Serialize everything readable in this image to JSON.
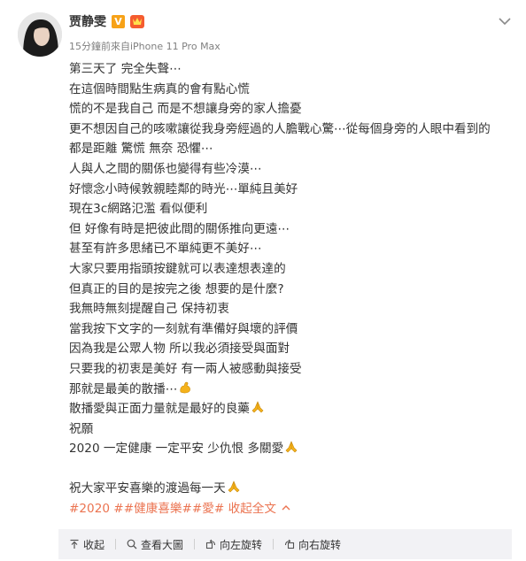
{
  "post": {
    "author": "贾静雯",
    "meta": "15分鐘前來自iPhone 11 Pro Max",
    "verified_badge": "V",
    "lines": [
      "第三天了 完全失聲⋯",
      "在這個時間點生病真的會有點心慌",
      "慌的不是我自己 而是不想讓身旁的家人擔憂",
      "更不想因自己的咳嗽讓從我身旁經過的人膽戰心驚⋯從每個身旁的人眼中看到的",
      "都是距離 驚慌 無奈 恐懼⋯",
      "人與人之間的關係也變得有些冷漠⋯",
      "好懷念小時候敦親睦鄰的時光⋯單純且美好",
      "現在3c網路氾濫 看似便利",
      "但 好像有時是把彼此間的關係推向更遠⋯",
      "甚至有許多思緒已不單純更不美好⋯",
      "大家只要用指頭按鍵就可以表達想表達的",
      "但真正的目的是按完之後 想要的是什麼?",
      "我無時無刻提醒自己 保持初衷",
      "當我按下文字的一刻就有準備好與壞的評價",
      "因為我是公眾人物 所以我必須接受與面對",
      "只要我的初衷是美好 有一兩人被感動與接受",
      "那就是最美的散播⋯",
      "散播愛與正面力量就是最好的良藥",
      "祝願",
      "2020 一定健康 一定平安 少仇恨 多關愛",
      "",
      "祝大家平安喜樂的渡過每一天"
    ],
    "tags": "#2020 ##健康喜樂##愛#",
    "collapse_label": "收起全文"
  },
  "toolbar": {
    "collapse": "收起",
    "view_large": "查看大圖",
    "rotate_left": "向左旋转",
    "rotate_right": "向右旋转"
  },
  "colors": {
    "accent": "#eb7350",
    "verified": "#f7a218",
    "toolbar_bg": "#f2f2f5"
  },
  "icons": [
    "more-chevron-icon",
    "verified-v-icon",
    "member-badge-icon",
    "flexed-bicep-emoji",
    "folded-hands-emoji",
    "chevron-up-icon",
    "arrow-up-icon",
    "search-icon",
    "rotate-left-icon",
    "rotate-right-icon"
  ]
}
